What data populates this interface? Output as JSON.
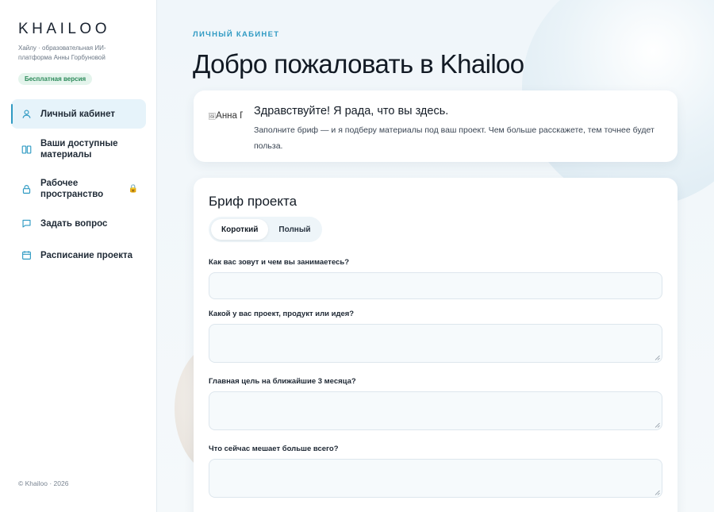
{
  "sidebar": {
    "logo": "KHAILOO",
    "tagline": "Хайлу · образовательная ИИ-платформа Анны Горбуновой",
    "badge": "Бесплатная версия",
    "items": [
      {
        "label": "Личный кабинет",
        "icon": "user-icon"
      },
      {
        "label": "Ваши доступные материалы",
        "icon": "book-icon"
      },
      {
        "label": "Рабочее пространство",
        "icon": "lock-icon",
        "locked_icon": "padlock-icon"
      },
      {
        "label": "Задать вопрос",
        "icon": "chat-icon"
      },
      {
        "label": "Расписание проекта",
        "icon": "calendar-icon"
      }
    ],
    "footer": "© Khailoo · 2026"
  },
  "header": {
    "kicker": "ЛИЧНЫЙ КАБИНЕТ",
    "title": "Добро пожаловать в Khailoo"
  },
  "welcome": {
    "avatar_alt": "Анна Горбунова",
    "title": "Здравствуйте! Я рада, что вы здесь.",
    "text": "Заполните бриф — и я подберу материалы под ваш проект. Чем больше расскажете, тем точнее будет польза."
  },
  "brief": {
    "title": "Бриф проекта",
    "tabs": [
      "Короткий",
      "Полный"
    ],
    "active_tab": "Короткий",
    "questions": [
      {
        "label": "Как вас зовут и чем вы занимаетесь?",
        "value": ""
      },
      {
        "label": "Какой у вас проект, продукт или идея?",
        "value": ""
      },
      {
        "label": "Главная цель на ближайшие 3 месяца?",
        "value": ""
      },
      {
        "label": "Что сейчас мешает больше всего?",
        "value": ""
      }
    ]
  },
  "colors": {
    "accent": "#2f9ac3",
    "active_nav_bg": "#e6f3fa",
    "badge_bg": "#e4f4ec",
    "badge_text": "#2c8a5a"
  }
}
